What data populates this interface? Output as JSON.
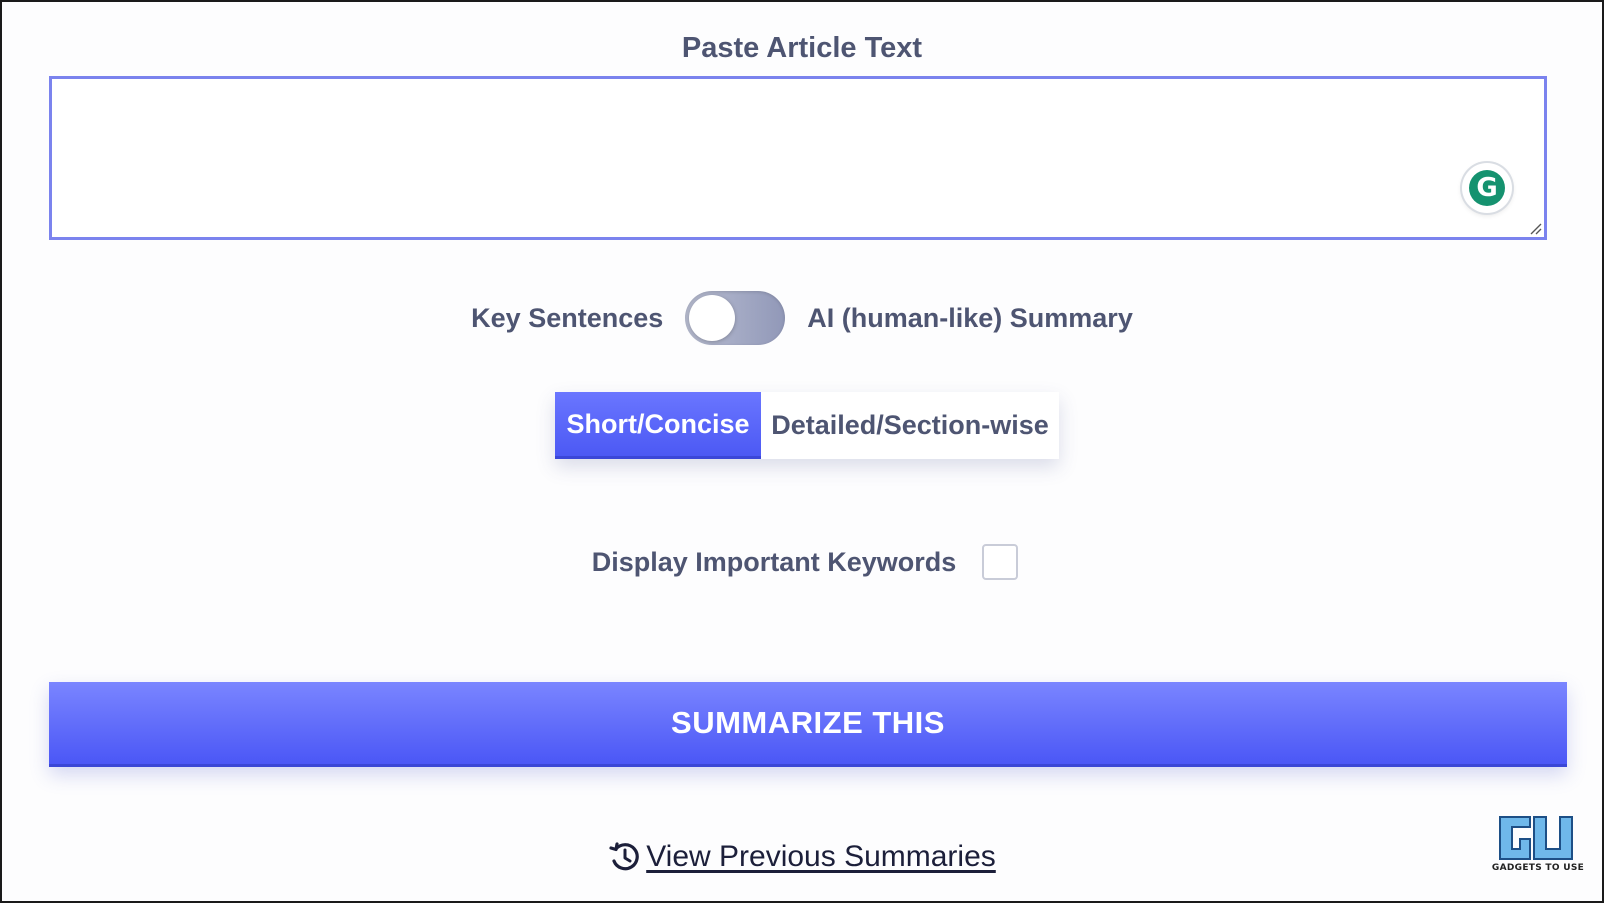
{
  "article": {
    "label": "Paste Article Text",
    "value": "",
    "placeholder": ""
  },
  "grammarly": {
    "icon": "grammarly-icon",
    "glyph": "G",
    "color": "#15926f"
  },
  "mode_toggle": {
    "left_label": "Key Sentences",
    "right_label": "AI (human-like) Summary",
    "state": "Key Sentences"
  },
  "length_options": {
    "items": [
      {
        "label": "Short/Concise",
        "selected": true
      },
      {
        "label": "Detailed/Section-wise",
        "selected": false
      }
    ]
  },
  "keywords": {
    "label": "Display Important Keywords",
    "checked": false
  },
  "summarize_button": {
    "label": "SUMMARIZE THIS"
  },
  "history": {
    "label": "View Previous Summaries",
    "icon": "history-icon"
  },
  "watermark": {
    "text": "GADGETS TO USE"
  },
  "colors": {
    "accent": "#4c59f4",
    "text": "#4e5572",
    "border": "#7b83ee"
  }
}
